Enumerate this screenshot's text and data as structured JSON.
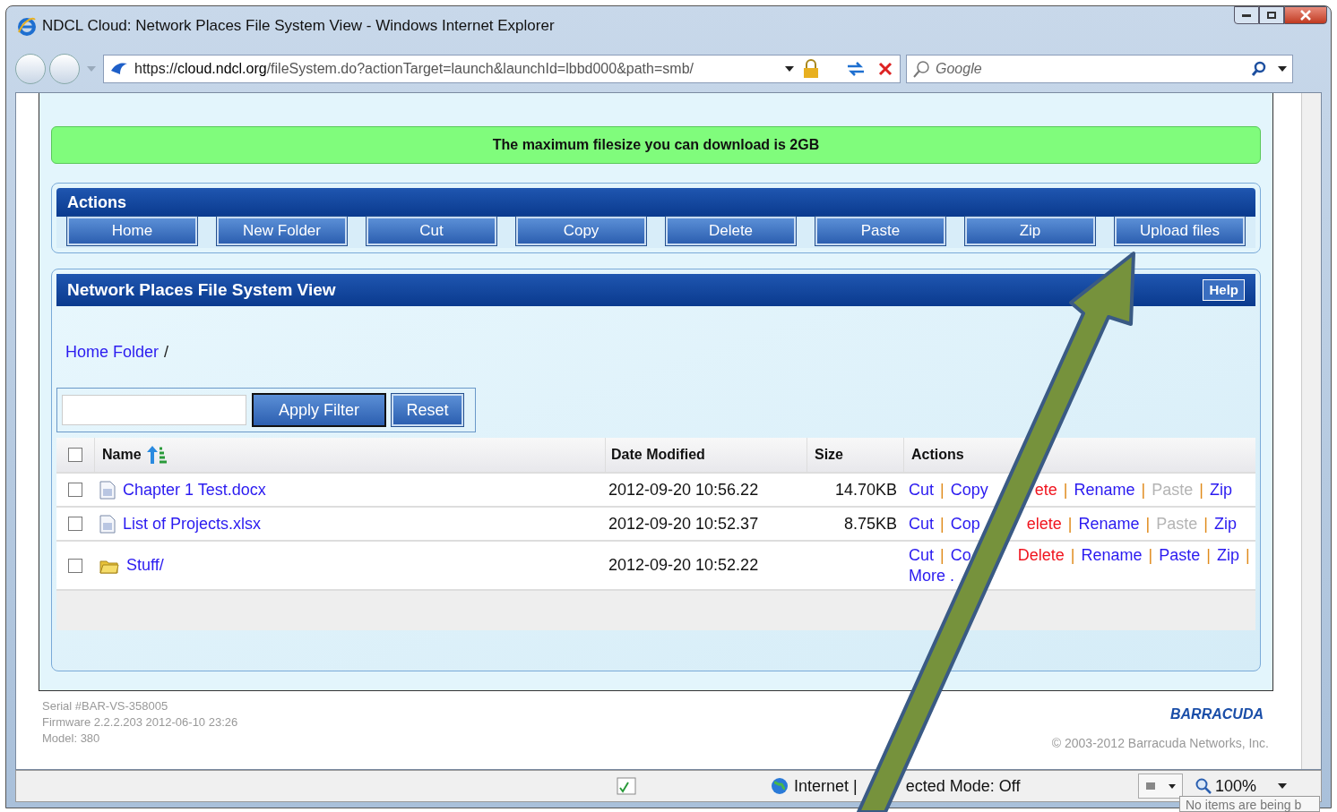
{
  "window": {
    "title": "NDCL Cloud: Network Places File System View - Windows Internet Explorer"
  },
  "address_bar": {
    "scheme": "https://",
    "host": "cloud.ndcl.org",
    "path": "/fileSystem.do?actionTarget=launch&launchId=lbbd000&path=smb/"
  },
  "search": {
    "placeholder": "Google"
  },
  "notice": "The maximum filesize you can download is 2GB",
  "actions_panel": {
    "title": "Actions",
    "buttons": [
      "Home",
      "New Folder",
      "Cut",
      "Copy",
      "Delete",
      "Paste",
      "Zip",
      "Upload files"
    ]
  },
  "file_panel": {
    "title": "Network Places File System View",
    "help": "Help",
    "breadcrumb": {
      "link": "Home Folder",
      "separator": "/"
    },
    "filter": {
      "apply": "Apply Filter",
      "reset": "Reset"
    },
    "table": {
      "all_checked": false,
      "columns": [
        "Name",
        "Date Modified",
        "Size",
        "Actions"
      ],
      "rows": [
        {
          "kind": "file",
          "checked": false,
          "name": "Chapter 1 Test.docx",
          "modified": "2012-09-20 10:56.22",
          "size": "14.70KB",
          "actions": [
            {
              "label": "Cut",
              "kind": "link"
            },
            {
              "label": "|",
              "kind": "separator"
            },
            {
              "label": "Copy",
              "kind": "link"
            },
            {
              "kind": "covered"
            },
            {
              "label": "ete",
              "kind": "danger"
            },
            {
              "label": "|",
              "kind": "separator"
            },
            {
              "label": "Rename",
              "kind": "link"
            },
            {
              "label": "|",
              "kind": "separator"
            },
            {
              "label": "Paste",
              "kind": "disabled"
            },
            {
              "label": "|",
              "kind": "separator"
            },
            {
              "label": "Zip",
              "kind": "link"
            }
          ]
        },
        {
          "kind": "file",
          "checked": false,
          "name": "List of Projects.xlsx",
          "modified": "2012-09-20 10:52.37",
          "size": "8.75KB",
          "actions": [
            {
              "label": "Cut",
              "kind": "link"
            },
            {
              "label": "|",
              "kind": "separator"
            },
            {
              "label": "Cop",
              "kind": "link"
            },
            {
              "kind": "covered"
            },
            {
              "label": "elete",
              "kind": "danger"
            },
            {
              "label": "|",
              "kind": "separator"
            },
            {
              "label": "Rename",
              "kind": "link"
            },
            {
              "label": "|",
              "kind": "separator"
            },
            {
              "label": "Paste",
              "kind": "disabled"
            },
            {
              "label": "|",
              "kind": "separator"
            },
            {
              "label": "Zip",
              "kind": "link"
            }
          ]
        },
        {
          "kind": "folder",
          "checked": false,
          "name": "Stuff/",
          "modified": "2012-09-20 10:52.22",
          "actions": [
            {
              "label": "Cut",
              "kind": "link"
            },
            {
              "label": "|",
              "kind": "separator"
            },
            {
              "label": "Co",
              "kind": "link"
            },
            {
              "kind": "covered"
            },
            {
              "label": "Delete",
              "kind": "danger"
            },
            {
              "label": "|",
              "kind": "separator"
            },
            {
              "label": "Rename",
              "kind": "link"
            },
            {
              "label": "|",
              "kind": "separator"
            },
            {
              "label": "Paste",
              "kind": "link"
            },
            {
              "label": "|",
              "kind": "separator"
            },
            {
              "label": "Zip",
              "kind": "link"
            },
            {
              "label": "|",
              "kind": "separator"
            },
            {
              "label": "More .",
              "kind": "link"
            }
          ]
        }
      ]
    }
  },
  "footer": {
    "lines": [
      "Serial #BAR-VS-358005",
      "Firmware 2.2.2.203 2012-06-10 23:26",
      "Model: 380"
    ],
    "logo": "BARRACUDA",
    "copyright": "© 2003-2012 Barracuda Networks, Inc."
  },
  "status_bar": {
    "zone": "Internet |",
    "mode": "ected Mode: Off",
    "zoom": "100%",
    "tooltip": "No items are being b"
  }
}
